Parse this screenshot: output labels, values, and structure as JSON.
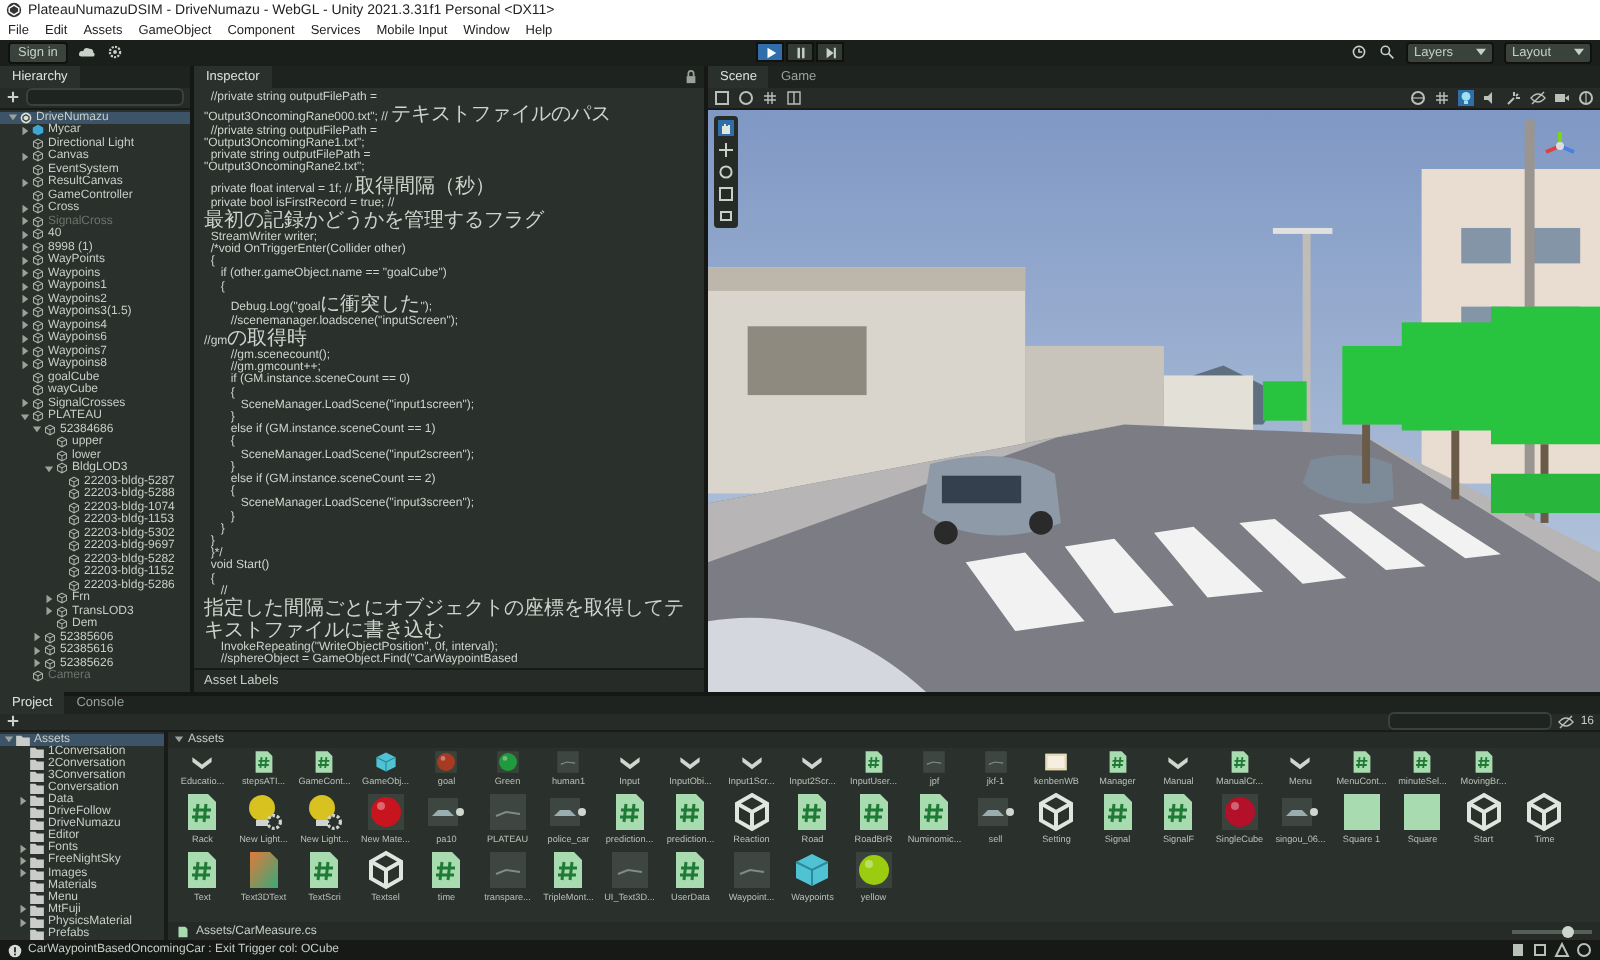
{
  "window": {
    "title": "PlateauNumazuDSIM - DriveNumazu - WebGL - Unity 2021.3.31f1 Personal <DX11>"
  },
  "menu": [
    "File",
    "Edit",
    "Assets",
    "GameObject",
    "Component",
    "Services",
    "Mobile Input",
    "Window",
    "Help"
  ],
  "toolbar": {
    "sign_in": "Sign in",
    "playing": true,
    "layers": "Layers",
    "layout": "Layout"
  },
  "hierarchy": {
    "tab": "Hierarchy",
    "items": [
      {
        "label": "DriveNumazu",
        "kind": "scene",
        "expanded": true,
        "selected": true,
        "disabled": false,
        "children": [
          {
            "label": "Mycar",
            "kind": "prefab",
            "expanded": false,
            "selected": false,
            "disabled": false
          },
          {
            "label": "Directional Light",
            "kind": "object",
            "selected": false,
            "disabled": false
          },
          {
            "label": "Canvas",
            "kind": "object",
            "expanded": false,
            "selected": false,
            "disabled": false
          },
          {
            "label": "EventSystem",
            "kind": "object",
            "selected": false,
            "disabled": false
          },
          {
            "label": "ResultCanvas",
            "kind": "object",
            "expanded": false,
            "selected": false,
            "disabled": false
          },
          {
            "label": "GameController",
            "kind": "object",
            "selected": false,
            "disabled": false
          },
          {
            "label": "Cross",
            "kind": "object",
            "expanded": false,
            "selected": false,
            "disabled": false
          },
          {
            "label": "SignalCross",
            "kind": "object",
            "expanded": false,
            "selected": false,
            "disabled": true
          },
          {
            "label": "40",
            "kind": "object",
            "expanded": false,
            "selected": false,
            "disabled": false
          },
          {
            "label": "8998 (1)",
            "kind": "object",
            "expanded": false,
            "selected": false,
            "disabled": false
          },
          {
            "label": "WayPoints",
            "kind": "object",
            "expanded": false,
            "selected": false,
            "disabled": false
          },
          {
            "label": "Waypoins",
            "kind": "object",
            "expanded": false,
            "selected": false,
            "disabled": false
          },
          {
            "label": "Waypoins1",
            "kind": "object",
            "expanded": false,
            "selected": false,
            "disabled": false
          },
          {
            "label": "Waypoins2",
            "kind": "object",
            "expanded": false,
            "selected": false,
            "disabled": false
          },
          {
            "label": "Waypoins3(1.5)",
            "kind": "object",
            "expanded": false,
            "selected": false,
            "disabled": false
          },
          {
            "label": "Waypoins4",
            "kind": "object",
            "expanded": false,
            "selected": false,
            "disabled": false
          },
          {
            "label": "Waypoins6",
            "kind": "object",
            "expanded": false,
            "selected": false,
            "disabled": false
          },
          {
            "label": "Waypoins7",
            "kind": "object",
            "expanded": false,
            "selected": false,
            "disabled": false
          },
          {
            "label": "Waypoins8",
            "kind": "object",
            "expanded": false,
            "selected": false,
            "disabled": false
          },
          {
            "label": "goalCube",
            "kind": "object",
            "selected": false,
            "disabled": false
          },
          {
            "label": "wayCube",
            "kind": "object",
            "selected": false,
            "disabled": false
          },
          {
            "label": "SignalCrosses",
            "kind": "object",
            "expanded": false,
            "selected": false,
            "disabled": false
          },
          {
            "label": "PLATEAU",
            "kind": "object",
            "expanded": true,
            "selected": false,
            "disabled": false,
            "children": [
              {
                "label": "52384686",
                "kind": "object",
                "expanded": true,
                "selected": false,
                "disabled": false,
                "children": [
                  {
                    "label": "upper",
                    "kind": "object",
                    "selected": false,
                    "disabled": false
                  },
                  {
                    "label": "lower",
                    "kind": "object",
                    "selected": false,
                    "disabled": false
                  },
                  {
                    "label": "BldgLOD3",
                    "kind": "object",
                    "expanded": true,
                    "selected": false,
                    "disabled": false,
                    "children": [
                      {
                        "label": "22203-bldg-5287",
                        "kind": "object",
                        "selected": false,
                        "disabled": false
                      },
                      {
                        "label": "22203-bldg-5288",
                        "kind": "object",
                        "selected": false,
                        "disabled": false
                      },
                      {
                        "label": "22203-bldg-1074",
                        "kind": "object",
                        "selected": false,
                        "disabled": false
                      },
                      {
                        "label": "22203-bldg-1153",
                        "kind": "object",
                        "selected": false,
                        "disabled": false
                      },
                      {
                        "label": "22203-bldg-5302",
                        "kind": "object",
                        "selected": false,
                        "disabled": false
                      },
                      {
                        "label": "22203-bldg-9697",
                        "kind": "object",
                        "selected": false,
                        "disabled": false
                      },
                      {
                        "label": "22203-bldg-5282",
                        "kind": "object",
                        "selected": false,
                        "disabled": false
                      },
                      {
                        "label": "22203-bldg-1152",
                        "kind": "object",
                        "selected": false,
                        "disabled": false
                      },
                      {
                        "label": "22203-bldg-5286",
                        "kind": "object",
                        "selected": false,
                        "disabled": false
                      }
                    ]
                  },
                  {
                    "label": "Frn",
                    "kind": "object",
                    "expanded": false,
                    "selected": false,
                    "disabled": false
                  },
                  {
                    "label": "TransLOD3",
                    "kind": "object",
                    "expanded": false,
                    "selected": false,
                    "disabled": false
                  },
                  {
                    "label": "Dem",
                    "kind": "object",
                    "selected": false,
                    "disabled": false
                  }
                ]
              },
              {
                "label": "52385606",
                "kind": "object",
                "expanded": false,
                "selected": false,
                "disabled": false
              },
              {
                "label": "52385616",
                "kind": "object",
                "expanded": false,
                "selected": false,
                "disabled": false
              },
              {
                "label": "52385626",
                "kind": "object",
                "expanded": false,
                "selected": false,
                "disabled": false
              }
            ]
          },
          {
            "label": "Camera",
            "kind": "object",
            "selected": false,
            "disabled": true
          }
        ]
      }
    ]
  },
  "inspector": {
    "tab": "Inspector",
    "code": [
      "  //private string outputFilePath =",
      "\"Output3OncomingRane000.txt\"; // テキストファイルのパス",
      "  //private string outputFilePath =",
      "\"Output3OncomingRane1.txt\";",
      "  private string outputFilePath =",
      "\"Output3OncomingRane2.txt\";",
      "  private float interval = 1f; // 取得間隔（秒）",
      "  private bool isFirstRecord = true; //",
      "最初の記録かどうかを管理するフラグ",
      "  StreamWriter writer;",
      "  /*void OnTriggerEnter(Collider other)",
      "  {",
      "     if (other.gameObject.name == \"goalCube\")",
      "     {",
      "        Debug.Log(\"goalに衝突した\");",
      "        //scenemanager.loadscene(\"inputScreen\");",
      "//gmの取得時",
      "        //gm.scenecount();",
      "        //gm.gmcount++;",
      "        if (GM.instance.sceneCount == 0)",
      "        {",
      "           SceneManager.LoadScene(\"input1screen\");",
      "        }",
      "        else if (GM.instance.sceneCount == 1)",
      "        {",
      "           SceneManager.LoadScene(\"input2screen\");",
      "        }",
      "        else if (GM.instance.sceneCount == 2)",
      "        {",
      "           SceneManager.LoadScene(\"input3screen\");",
      "        }",
      "     }",
      "  }",
      "  }*/",
      "  void Start()",
      "  {",
      "     //",
      "指定した間隔ごとにオブジェクトの座標を取得してテキストファイルに書き込む",
      "     InvokeRepeating(\"WriteObjectPosition\", 0f, interval);",
      "     //sphereObject = GameObject.Find(\"CarWaypointBased"
    ],
    "footer": "Asset Labels"
  },
  "views": {
    "tabs": [
      {
        "label": "Scene",
        "selected": true
      },
      {
        "label": "Game",
        "selected": false
      }
    ]
  },
  "project": {
    "tabs": [
      {
        "label": "Project",
        "selected": true
      },
      {
        "label": "Console",
        "selected": false
      }
    ],
    "hidden_count": "16",
    "folders": [
      {
        "label": "Assets",
        "expanded": true,
        "selected": true,
        "children": [
          {
            "label": "1Conversation",
            "selected": false
          },
          {
            "label": "2Conversation",
            "selected": false
          },
          {
            "label": "3Conversation",
            "selected": false
          },
          {
            "label": "Conversation",
            "selected": false
          },
          {
            "label": "Data",
            "expanded": false,
            "selected": false
          },
          {
            "label": "DriveFollow",
            "selected": false
          },
          {
            "label": "DriveNumazu",
            "selected": false
          },
          {
            "label": "Editor",
            "selected": false
          },
          {
            "label": "Fonts",
            "expanded": false,
            "selected": false
          },
          {
            "label": "FreeNightSky",
            "expanded": false,
            "selected": false
          },
          {
            "label": "Images",
            "expanded": false,
            "selected": false
          },
          {
            "label": "Materials",
            "selected": false
          },
          {
            "label": "Menu",
            "selected": false
          },
          {
            "label": "MtFuji",
            "expanded": false,
            "selected": false
          },
          {
            "label": "PhysicsMaterial",
            "expanded": false,
            "selected": false
          },
          {
            "label": "Prefabs",
            "selected": false
          }
        ]
      }
    ],
    "breadcrumb": "Assets",
    "asset_rows": [
      [
        {
          "name": "Educatio...",
          "kind": "chevron"
        },
        {
          "name": "stepsATI...",
          "kind": "script"
        },
        {
          "name": "GameCont...",
          "kind": "script"
        },
        {
          "name": "GameObj...",
          "kind": "cube"
        },
        {
          "name": "goal",
          "kind": "sphere",
          "color": "#a83a22"
        },
        {
          "name": "Green",
          "kind": "sphere",
          "color": "#1f9a3c"
        },
        {
          "name": "human1",
          "kind": "thumb"
        },
        {
          "name": "Input",
          "kind": "chevron"
        },
        {
          "name": "InputObi...",
          "kind": "chevron"
        },
        {
          "name": "Input1Scr...",
          "kind": "chevron"
        },
        {
          "name": "Input2Scr...",
          "kind": "chevron"
        },
        {
          "name": "InputUser...",
          "kind": "script"
        },
        {
          "name": "jpf",
          "kind": "thumb"
        },
        {
          "name": "jkf-1",
          "kind": "thumb"
        },
        {
          "name": "kenbenWB",
          "kind": "image"
        },
        {
          "name": "Manager",
          "kind": "script"
        },
        {
          "name": "Manual",
          "kind": "chevron"
        },
        {
          "name": "ManualCr...",
          "kind": "script"
        },
        {
          "name": "Menu",
          "kind": "chevron"
        },
        {
          "name": "MenuCont...",
          "kind": "script"
        },
        {
          "name": "minuteSel...",
          "kind": "script"
        },
        {
          "name": "MovingBr...",
          "kind": "script"
        }
      ],
      [
        {
          "name": "Rack",
          "kind": "script"
        },
        {
          "name": "New Light...",
          "kind": "light"
        },
        {
          "name": "New Light...",
          "kind": "light"
        },
        {
          "name": "New Mate...",
          "kind": "sphere",
          "color": "#c8141e"
        },
        {
          "name": "pa10",
          "kind": "model"
        },
        {
          "name": "PLATEAU",
          "kind": "thumb"
        },
        {
          "name": "police_car",
          "kind": "model"
        },
        {
          "name": "prediction...",
          "kind": "script"
        },
        {
          "name": "prediction...",
          "kind": "script"
        },
        {
          "name": "Reaction",
          "kind": "unity"
        },
        {
          "name": "Road",
          "kind": "script"
        },
        {
          "name": "RoadBrR",
          "kind": "script"
        },
        {
          "name": "Numinomic...",
          "kind": "script"
        },
        {
          "name": "sell",
          "kind": "model"
        },
        {
          "name": "Setting",
          "kind": "unity"
        },
        {
          "name": "Signal",
          "kind": "script"
        },
        {
          "name": "SignalF",
          "kind": "script"
        },
        {
          "name": "SingleCube",
          "kind": "sphere",
          "color": "#b5102a"
        },
        {
          "name": "singou_06...",
          "kind": "model"
        },
        {
          "name": "Square 1",
          "kind": "square"
        },
        {
          "name": "Square",
          "kind": "square"
        },
        {
          "name": "Start",
          "kind": "unity"
        },
        {
          "name": "Time",
          "kind": "unity"
        }
      ],
      [
        {
          "name": "Text",
          "kind": "script"
        },
        {
          "name": "Text3DText",
          "kind": "shader"
        },
        {
          "name": "TextScri",
          "kind": "script"
        },
        {
          "name": "Textsel",
          "kind": "unity"
        },
        {
          "name": "time",
          "kind": "script"
        },
        {
          "name": "transpare...",
          "kind": "thumb"
        },
        {
          "name": "TripleMont...",
          "kind": "script"
        },
        {
          "name": "UI_Text3D...",
          "kind": "thumb"
        },
        {
          "name": "UserData",
          "kind": "script"
        },
        {
          "name": "Waypoint...",
          "kind": "thumb"
        },
        {
          "name": "Waypoints",
          "kind": "cube"
        },
        {
          "name": "yellow",
          "kind": "sphere",
          "color": "#9ccc10"
        }
      ]
    ],
    "selected_path": "Assets/CarMeasure.cs",
    "zoom_slider": {
      "level": 0.7
    }
  },
  "status_bar": {
    "message": "CarWaypointBasedOncomingCar : Exit Trigger col: OCube"
  }
}
